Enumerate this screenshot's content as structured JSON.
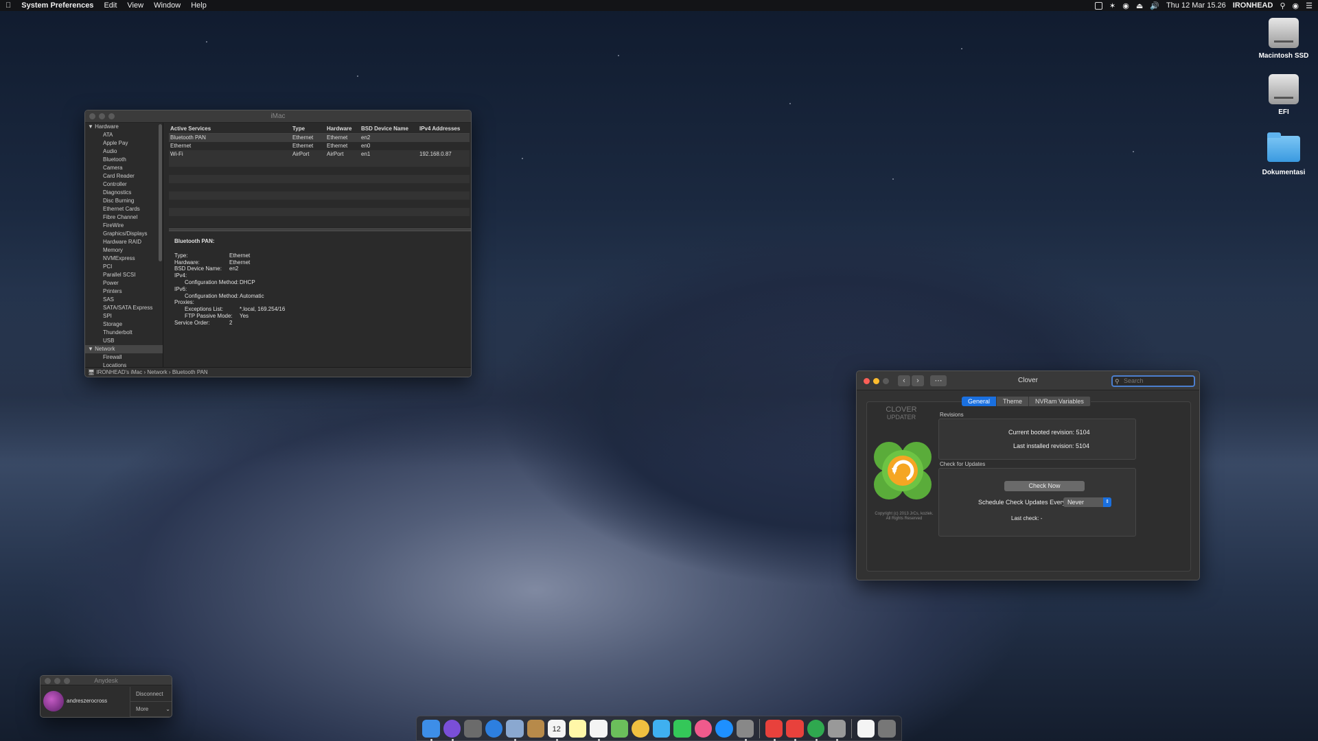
{
  "menubar": {
    "app_name": "System Preferences",
    "items": [
      "Edit",
      "View",
      "Window",
      "Help"
    ],
    "clock": "Thu 12 Mar  15.26",
    "user": "IRONHEAD"
  },
  "desktop_icons": [
    "Macintosh SSD",
    "EFI",
    "Dokumentasi"
  ],
  "sysinfo": {
    "title": "iMac",
    "sidebar": {
      "hardware_label": "Hardware",
      "hardware_items": [
        "ATA",
        "Apple Pay",
        "Audio",
        "Bluetooth",
        "Camera",
        "Card Reader",
        "Controller",
        "Diagnostics",
        "Disc Burning",
        "Ethernet Cards",
        "Fibre Channel",
        "FireWire",
        "Graphics/Displays",
        "Hardware RAID",
        "Memory",
        "NVMExpress",
        "PCI",
        "Parallel SCSI",
        "Power",
        "Printers",
        "SAS",
        "SATA/SATA Express",
        "SPI",
        "Storage",
        "Thunderbolt",
        "USB"
      ],
      "network_label": "Network",
      "network_items": [
        "Firewall",
        "Locations"
      ]
    },
    "table": {
      "headers": [
        "Active Services",
        "Type",
        "Hardware",
        "BSD Device Name",
        "IPv4 Addresses"
      ],
      "rows": [
        [
          "Bluetooth PAN",
          "Ethernet",
          "Ethernet",
          "en2",
          ""
        ],
        [
          "Ethernet",
          "Ethernet",
          "Ethernet",
          "en0",
          ""
        ],
        [
          "Wi-Fi",
          "AirPort",
          "AirPort",
          "en1",
          "192.168.0.87"
        ]
      ]
    },
    "detail": {
      "heading": "Bluetooth PAN:",
      "type_k": "Type:",
      "type_v": "Ethernet",
      "hw_k": "Hardware:",
      "hw_v": "Ethernet",
      "bsd_k": "BSD Device Name:",
      "bsd_v": "en2",
      "ipv4_k": "IPv4:",
      "cfg4_k": "Configuration Method:",
      "cfg4_v": "DHCP",
      "ipv6_k": "IPv6:",
      "cfg6_k": "Configuration Method:",
      "cfg6_v": "Automatic",
      "proxies_k": "Proxies:",
      "exc_k": "Exceptions List:",
      "exc_v": "*.local, 169.254/16",
      "ftp_k": "FTP Passive Mode:",
      "ftp_v": "Yes",
      "order_k": "Service Order:",
      "order_v": "2"
    },
    "path": "IRONHEAD's iMac  ›  Network  ›  Bluetooth PAN"
  },
  "clover": {
    "title": "Clover",
    "search_placeholder": "Search",
    "tabs": [
      "General",
      "Theme",
      "NVRam Variables"
    ],
    "logo_line1": "CLOVER",
    "logo_line2": "UPDATER",
    "copyright_1": "Copyright (c) 2013 JrCs, kozlek.",
    "copyright_2": "All Rights Reserved",
    "revisions_label": "Revisions",
    "current_rev": "Current booted revision:  5104",
    "last_rev": "Last installed revision:  5104",
    "check_label": "Check for Updates",
    "check_button": "Check Now",
    "schedule_label": "Schedule Check Updates Every:",
    "schedule_value": "Never",
    "last_check": "Last check: -"
  },
  "anydesk": {
    "title": "Anydesk",
    "user": "andreszerocross",
    "disconnect": "Disconnect",
    "more": "More"
  },
  "dock_apps": [
    "finder-icon",
    "siri-icon",
    "launchpad-icon",
    "safari-icon",
    "preview-icon",
    "notes-brown-icon",
    "calendar-icon",
    "stickies-icon",
    "reminders-icon",
    "maps-icon",
    "photos-icon",
    "messages-icon",
    "facetime-icon",
    "itunes-icon",
    "app-store-icon",
    "system-preferences-icon",
    "anydesk-icon",
    "anydesk2-icon",
    "network-radar-icon",
    "script-icon",
    "document-icon",
    "trash-icon"
  ],
  "calendar_day": "12"
}
